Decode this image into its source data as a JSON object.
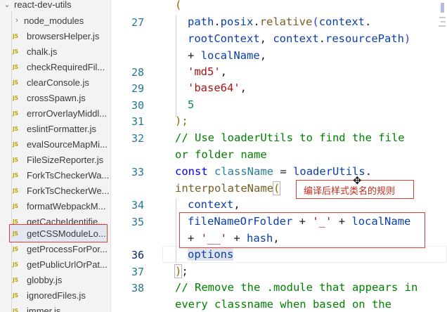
{
  "sidebar": {
    "root": {
      "chevron": "⌄",
      "label": "react-dev-utils"
    },
    "items": [
      {
        "kind": "folder",
        "chevron": "›",
        "label": "node_modules"
      },
      {
        "kind": "js",
        "badge": "JS",
        "label": "browsersHelper.js"
      },
      {
        "kind": "js",
        "badge": "JS",
        "label": "chalk.js"
      },
      {
        "kind": "js",
        "badge": "JS",
        "label": "checkRequiredFil..."
      },
      {
        "kind": "js",
        "badge": "JS",
        "label": "clearConsole.js"
      },
      {
        "kind": "js",
        "badge": "JS",
        "label": "crossSpawn.js"
      },
      {
        "kind": "js",
        "badge": "JS",
        "label": "errorOverlayMiddl..."
      },
      {
        "kind": "js",
        "badge": "JS",
        "label": "eslintFormatter.js"
      },
      {
        "kind": "js",
        "badge": "JS",
        "label": "evalSourceMapMi..."
      },
      {
        "kind": "js",
        "badge": "JS",
        "label": "FileSizeReporter.js"
      },
      {
        "kind": "js",
        "badge": "JS",
        "label": "ForkTsCheckerWa..."
      },
      {
        "kind": "js",
        "badge": "JS",
        "label": "ForkTsCheckerWe..."
      },
      {
        "kind": "js",
        "badge": "JS",
        "label": "formatWebpackM..."
      },
      {
        "kind": "js",
        "badge": "JS",
        "label": "getCacheIdentifie..."
      },
      {
        "kind": "js",
        "badge": "JS",
        "label": "getCSSModuleLo...",
        "selected": true
      },
      {
        "kind": "js",
        "badge": "JS",
        "label": "getProcessForPor..."
      },
      {
        "kind": "js",
        "badge": "JS",
        "label": "getPublicUrlOrPat..."
      },
      {
        "kind": "js",
        "badge": "JS",
        "label": "globby.js"
      },
      {
        "kind": "js",
        "badge": "JS",
        "label": "ignoredFiles.js"
      },
      {
        "kind": "js",
        "badge": "JS",
        "label": "immer.js"
      }
    ]
  },
  "editor": {
    "line_numbers": [
      "27",
      "28",
      "29",
      "30",
      "31",
      "32",
      "33",
      "34",
      "35",
      "36",
      "37",
      "38"
    ],
    "active_line": "36",
    "annotation": "编译后样式类名的规则",
    "tokens": {
      "open_paren": "(",
      "path": "path",
      "posix": "posix",
      "relative": "relative",
      "context": "context",
      "rootContext": "rootContext",
      "resourcePath": "resourcePath",
      "plus": "+",
      "localName": "localName",
      "str_md5": "'md5'",
      "str_base64": "'base64'",
      "num_5": "5",
      "close_call": ");",
      "comment1a": "// Use loaderUtils to find the file",
      "comment1b": "or folder name",
      "const": "const",
      "className": "className",
      "eq": "=",
      "loaderUtils": "loaderUtils",
      "interpolateName": "interpolateName",
      "fileNameOrFolder": "fileNameOrFolder",
      "str_underscore": "'_'",
      "str_dunder": "'__'",
      "hash": "hash",
      "options": "options",
      "comment2a": "// Remove the .module that appears in",
      "comment2b": "every classname when based on the"
    }
  },
  "colors": {
    "accent_red": "#d9403a",
    "line_number": "#237893",
    "string": "#a31515",
    "keyword": "#0000ff",
    "comment": "#008000"
  }
}
